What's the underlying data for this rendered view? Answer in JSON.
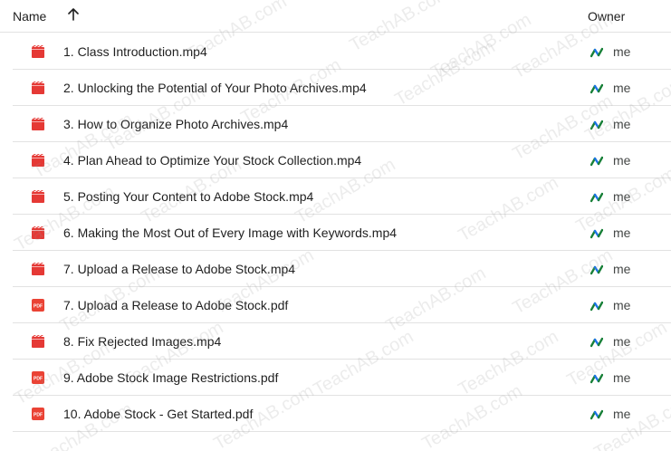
{
  "header": {
    "name_label": "Name",
    "owner_label": "Owner",
    "sort_icon": "arrow-up-icon"
  },
  "colors": {
    "video_icon": "#e53935",
    "pdf_icon": "#ea4335",
    "owner_icon_blue": "#1a73e8",
    "owner_icon_green": "#188038"
  },
  "files": [
    {
      "name": "1. Class Introduction.mp4",
      "type": "video",
      "icon": "video-file-icon",
      "owner": "me"
    },
    {
      "name": "2. Unlocking the Potential of Your Photo Archives.mp4",
      "type": "video",
      "icon": "video-file-icon",
      "owner": "me"
    },
    {
      "name": "3. How to Organize Photo Archives.mp4",
      "type": "video",
      "icon": "video-file-icon",
      "owner": "me"
    },
    {
      "name": "4. Plan Ahead to Optimize Your Stock Collection.mp4",
      "type": "video",
      "icon": "video-file-icon",
      "owner": "me"
    },
    {
      "name": "5. Posting Your Content to Adobe Stock.mp4",
      "type": "video",
      "icon": "video-file-icon",
      "owner": "me"
    },
    {
      "name": "6. Making the Most Out of Every Image with Keywords.mp4",
      "type": "video",
      "icon": "video-file-icon",
      "owner": "me"
    },
    {
      "name": "7. Upload a Release to Adobe Stock.mp4",
      "type": "video",
      "icon": "video-file-icon",
      "owner": "me"
    },
    {
      "name": "7. Upload a Release to Adobe Stock.pdf",
      "type": "pdf",
      "icon": "pdf-file-icon",
      "owner": "me"
    },
    {
      "name": "8. Fix Rejected Images.mp4",
      "type": "video",
      "icon": "video-file-icon",
      "owner": "me"
    },
    {
      "name": "9. Adobe Stock Image Restrictions.pdf",
      "type": "pdf",
      "icon": "pdf-file-icon",
      "owner": "me"
    },
    {
      "name": "10. Adobe Stock - Get Started.pdf",
      "type": "pdf",
      "icon": "pdf-file-icon",
      "owner": "me"
    }
  ],
  "watermark_text": "TeachAB.com"
}
